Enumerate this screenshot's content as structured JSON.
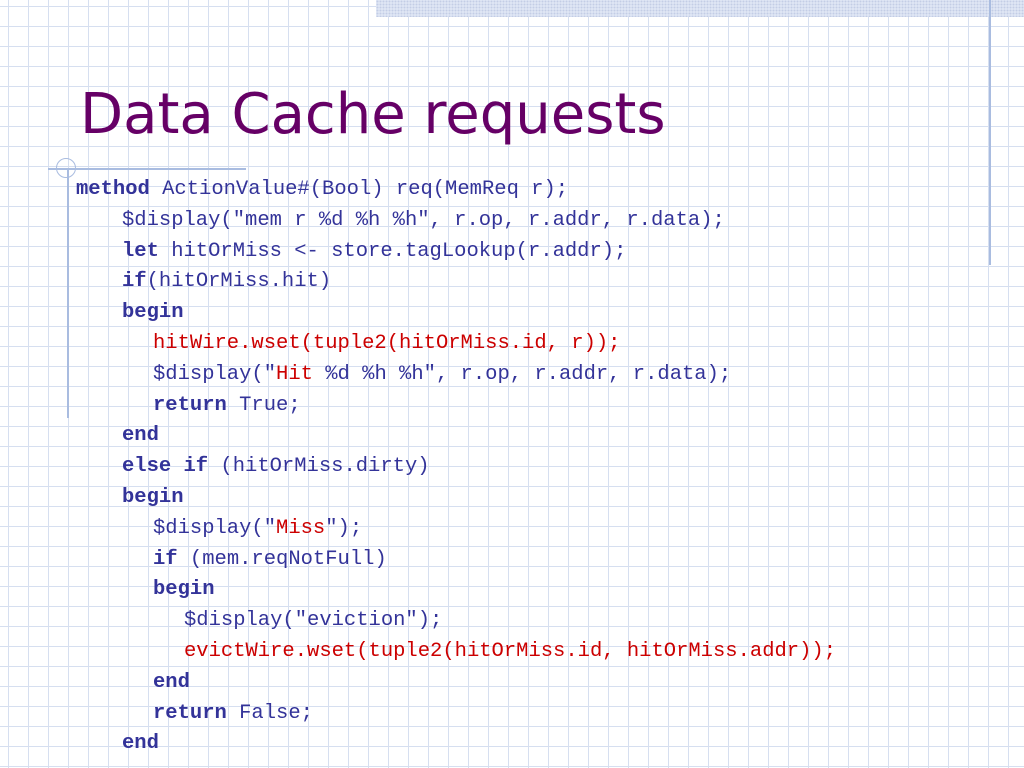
{
  "slide": {
    "title": "Data Cache requests"
  },
  "colors": {
    "title": "#660066",
    "code": "#333399",
    "highlight": "#cc0000",
    "grid": "#d6dff0",
    "accent_line": "#a9bce0"
  },
  "code": {
    "l1_kw": "method",
    "l1_text": " ActionValue#(Bool) req(MemReq r);",
    "l2_text": "$display(\"mem r %d %h %h\", r.op, r.addr, r.data);",
    "l3_kw": "let",
    "l3_text": " hitOrMiss <- store.tagLookup(r.addr);",
    "l4_kw": "if",
    "l4_text": "(hitOrMiss.hit)",
    "l5_kw": "begin",
    "l6_red": "hitWire.wset(tuple2(hitOrMiss.id, r));",
    "l7_pre": "$display(\"",
    "l7_red": "Hit",
    "l7_post": " %d %h %h\", r.op, r.addr, r.data);",
    "l8_kw": "return",
    "l8_text": " True;",
    "l9_kw": "end",
    "l10_kw": "else if",
    "l10_text": " (hitOrMiss.dirty)",
    "l11_kw": "begin",
    "l12_pre": "$display(\"",
    "l12_red": "Miss",
    "l12_post": "\");",
    "l13_kw": "if",
    "l13_text": " (mem.reqNotFull)",
    "l14_kw": "begin",
    "l15_text": "$display(\"eviction\");",
    "l16_red": "evictWire.wset(tuple2(hitOrMiss.id, hitOrMiss.addr));",
    "l17_kw": "end",
    "l18_kw": "return",
    "l18_text": " False;",
    "l19_kw": "end"
  }
}
